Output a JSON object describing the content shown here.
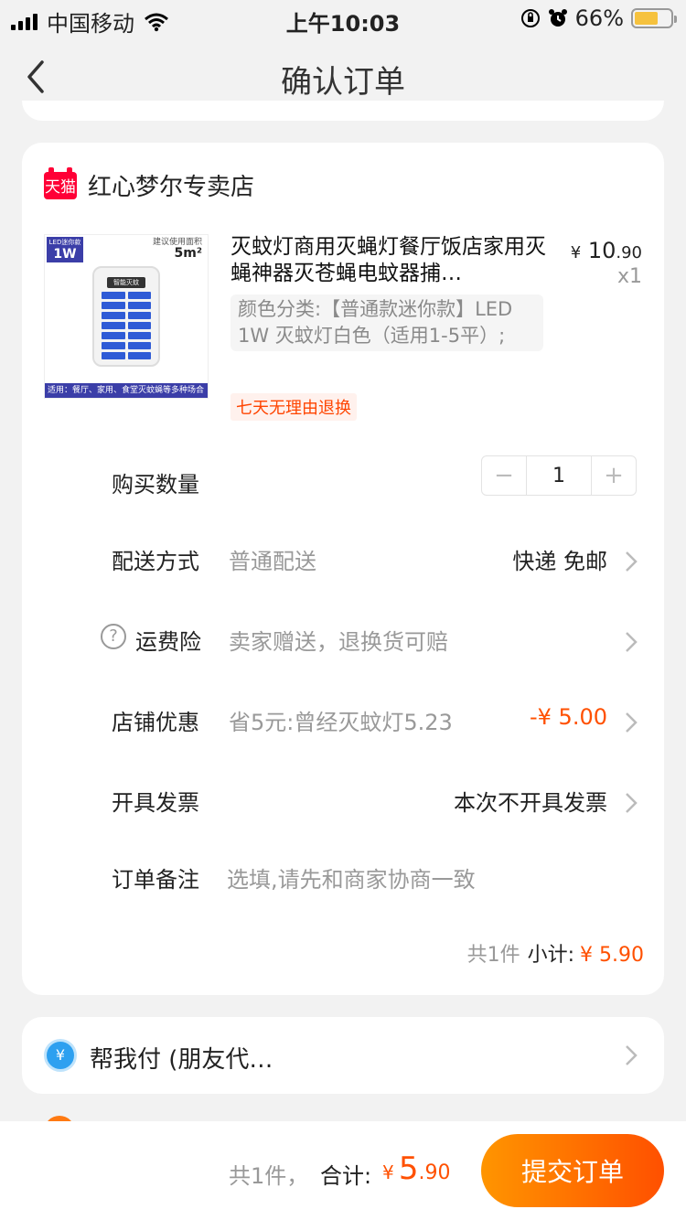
{
  "status_bar": {
    "carrier": "中国移动",
    "time": "上午10:03",
    "battery": "66%",
    "battery_level": 0.66
  },
  "nav": {
    "title": "确认订单"
  },
  "shop": {
    "badge": "天猫",
    "name": "红心梦尔专卖店"
  },
  "product": {
    "thumb_tag_line1": "LED迷你款",
    "thumb_tag_line2": "1W",
    "thumb_area_label": "建议使用面积",
    "thumb_area_value": "5m²",
    "thumb_brand": "智能灭蚊",
    "thumb_bottom": "适用：餐厅、家用、食堂灭蚊蝇等多种场合",
    "title": "灭蚊灯商用灭蝇灯餐厅饭店家用灭蝇神器灭苍蝇电蚊器捕…",
    "price_symbol": "¥",
    "price_int": "10",
    "price_dec": ".90",
    "quantity_text": "x1",
    "sku": "颜色分类:【普通款迷你款】LED 1W 灭蚊灯白色（适用1-5平）;",
    "badge": "七天无理由退换"
  },
  "quantity": {
    "label": "购买数量",
    "value": "1",
    "minus": "−",
    "plus": "+"
  },
  "delivery": {
    "label": "配送方式",
    "sub": "普通配送",
    "value": "快递 免邮"
  },
  "insurance": {
    "label": "运费险",
    "sub": "卖家赠送，退换货可赔",
    "icon": "?"
  },
  "discount": {
    "label": "店铺优惠",
    "sub": "省5元:曾经灭蚊灯5.23",
    "value": "-¥ 5.00"
  },
  "invoice": {
    "label": "开具发票",
    "value": "本次不开具发票"
  },
  "note": {
    "label": "订单备注",
    "placeholder": "选填,请先和商家协商一致"
  },
  "subtotal": {
    "count": "共1件",
    "label": "小计:",
    "value": "¥ 5.90"
  },
  "pay_for_me": {
    "icon": "¥",
    "label": "帮我付 (朋友代…"
  },
  "bottom": {
    "count": "共1件，",
    "total_label": "合计:",
    "symbol": "¥",
    "int": "5",
    "dec": ".90",
    "submit": "提交订单"
  }
}
